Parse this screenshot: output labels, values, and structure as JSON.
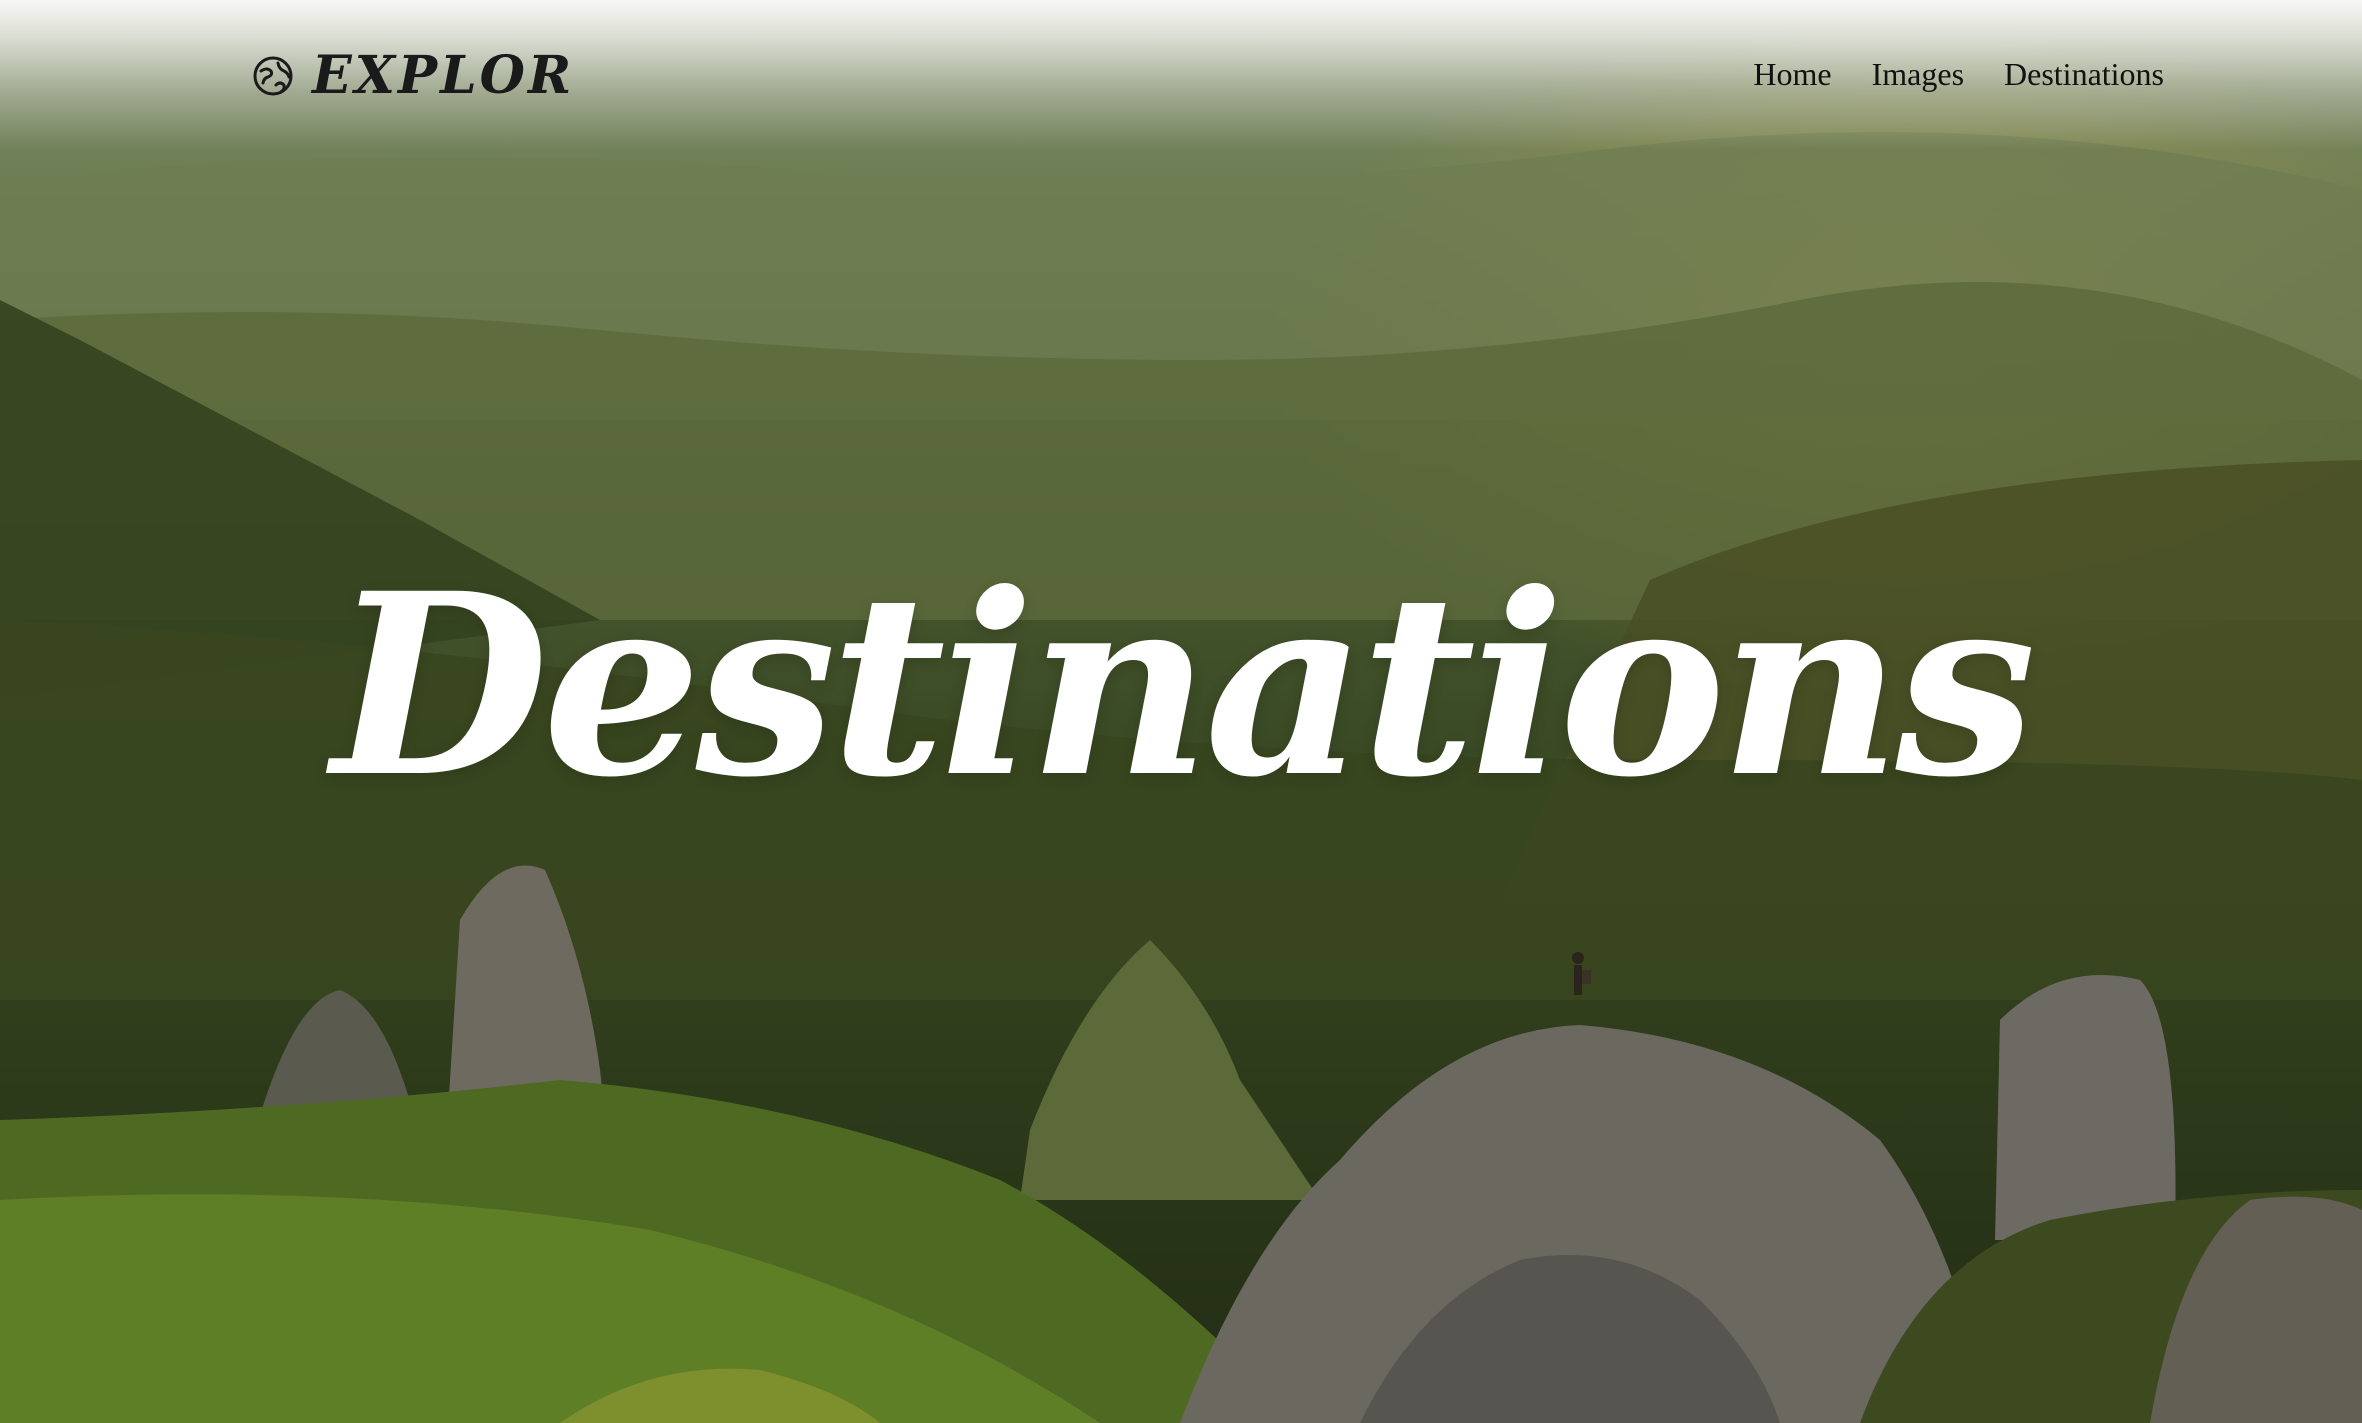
{
  "brand": {
    "name": "EXPLOR",
    "icon": "globe-icon"
  },
  "nav": {
    "items": [
      {
        "label": "Home"
      },
      {
        "label": "Images"
      },
      {
        "label": "Destinations"
      }
    ]
  },
  "hero": {
    "title": "Destinations",
    "background": "mountain-landscape-image"
  },
  "colors": {
    "title_text": "#ffffff",
    "nav_text": "#111111",
    "brand_text": "#1a1a1a"
  }
}
